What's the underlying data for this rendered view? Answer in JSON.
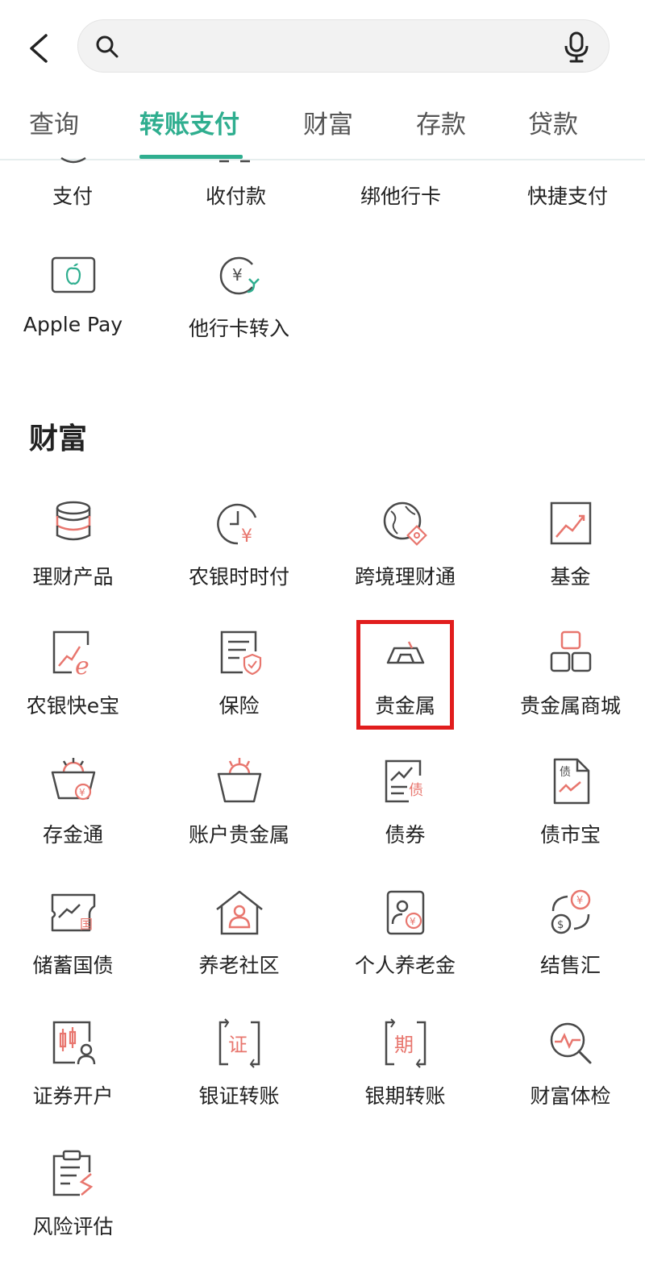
{
  "search": {
    "value": "",
    "placeholder": ""
  },
  "tabs": [
    {
      "label": "查询"
    },
    {
      "label": "转账支付"
    },
    {
      "label": "财富"
    },
    {
      "label": "存款"
    },
    {
      "label": "贷款"
    }
  ],
  "payment_partial": {
    "items": [
      {
        "label": "支付"
      },
      {
        "label": "收付款"
      },
      {
        "label": "绑他行卡"
      },
      {
        "label": "快捷支付"
      }
    ]
  },
  "payment_more": {
    "items": [
      {
        "label": "Apple Pay",
        "icon": "apple-pay-icon"
      },
      {
        "label": "他行卡转入",
        "icon": "yuan-transfer-in-icon"
      }
    ]
  },
  "wealth": {
    "title": "财富",
    "items": [
      {
        "label": "理财产品",
        "icon": "coin-stack-icon"
      },
      {
        "label": "农银时时付",
        "icon": "clock-yuan-icon"
      },
      {
        "label": "跨境理财通",
        "icon": "globe-icon"
      },
      {
        "label": "基金",
        "icon": "trend-chart-icon"
      },
      {
        "label": "农银快e宝",
        "icon": "e-chart-icon"
      },
      {
        "label": "保险",
        "icon": "insurance-doc-icon"
      },
      {
        "label": "贵金属",
        "icon": "gold-bar-icon"
      },
      {
        "label": "贵金属商城",
        "icon": "gold-blocks-icon"
      },
      {
        "label": "存金通",
        "icon": "gold-bowl-yuan-icon"
      },
      {
        "label": "账户贵金属",
        "icon": "gold-bowl-icon"
      },
      {
        "label": "债券",
        "icon": "bond-chart-icon"
      },
      {
        "label": "债市宝",
        "icon": "bond-doc-icon"
      },
      {
        "label": "储蓄国债",
        "icon": "treasury-bond-icon"
      },
      {
        "label": "养老社区",
        "icon": "senior-house-icon"
      },
      {
        "label": "个人养老金",
        "icon": "pension-icon"
      },
      {
        "label": "结售汇",
        "icon": "currency-exchange-icon"
      },
      {
        "label": "证券开户",
        "icon": "securities-account-icon"
      },
      {
        "label": "银证转账",
        "icon": "bank-securities-icon"
      },
      {
        "label": "银期转账",
        "icon": "bank-futures-icon"
      },
      {
        "label": "财富体检",
        "icon": "wealth-checkup-icon"
      },
      {
        "label": "风险评估",
        "icon": "risk-assessment-icon"
      }
    ]
  },
  "colors": {
    "accent": "#2fae8f",
    "icon_red": "#e8766e",
    "icon_gray": "#4a4a4a",
    "highlight": "#e11d1d"
  }
}
